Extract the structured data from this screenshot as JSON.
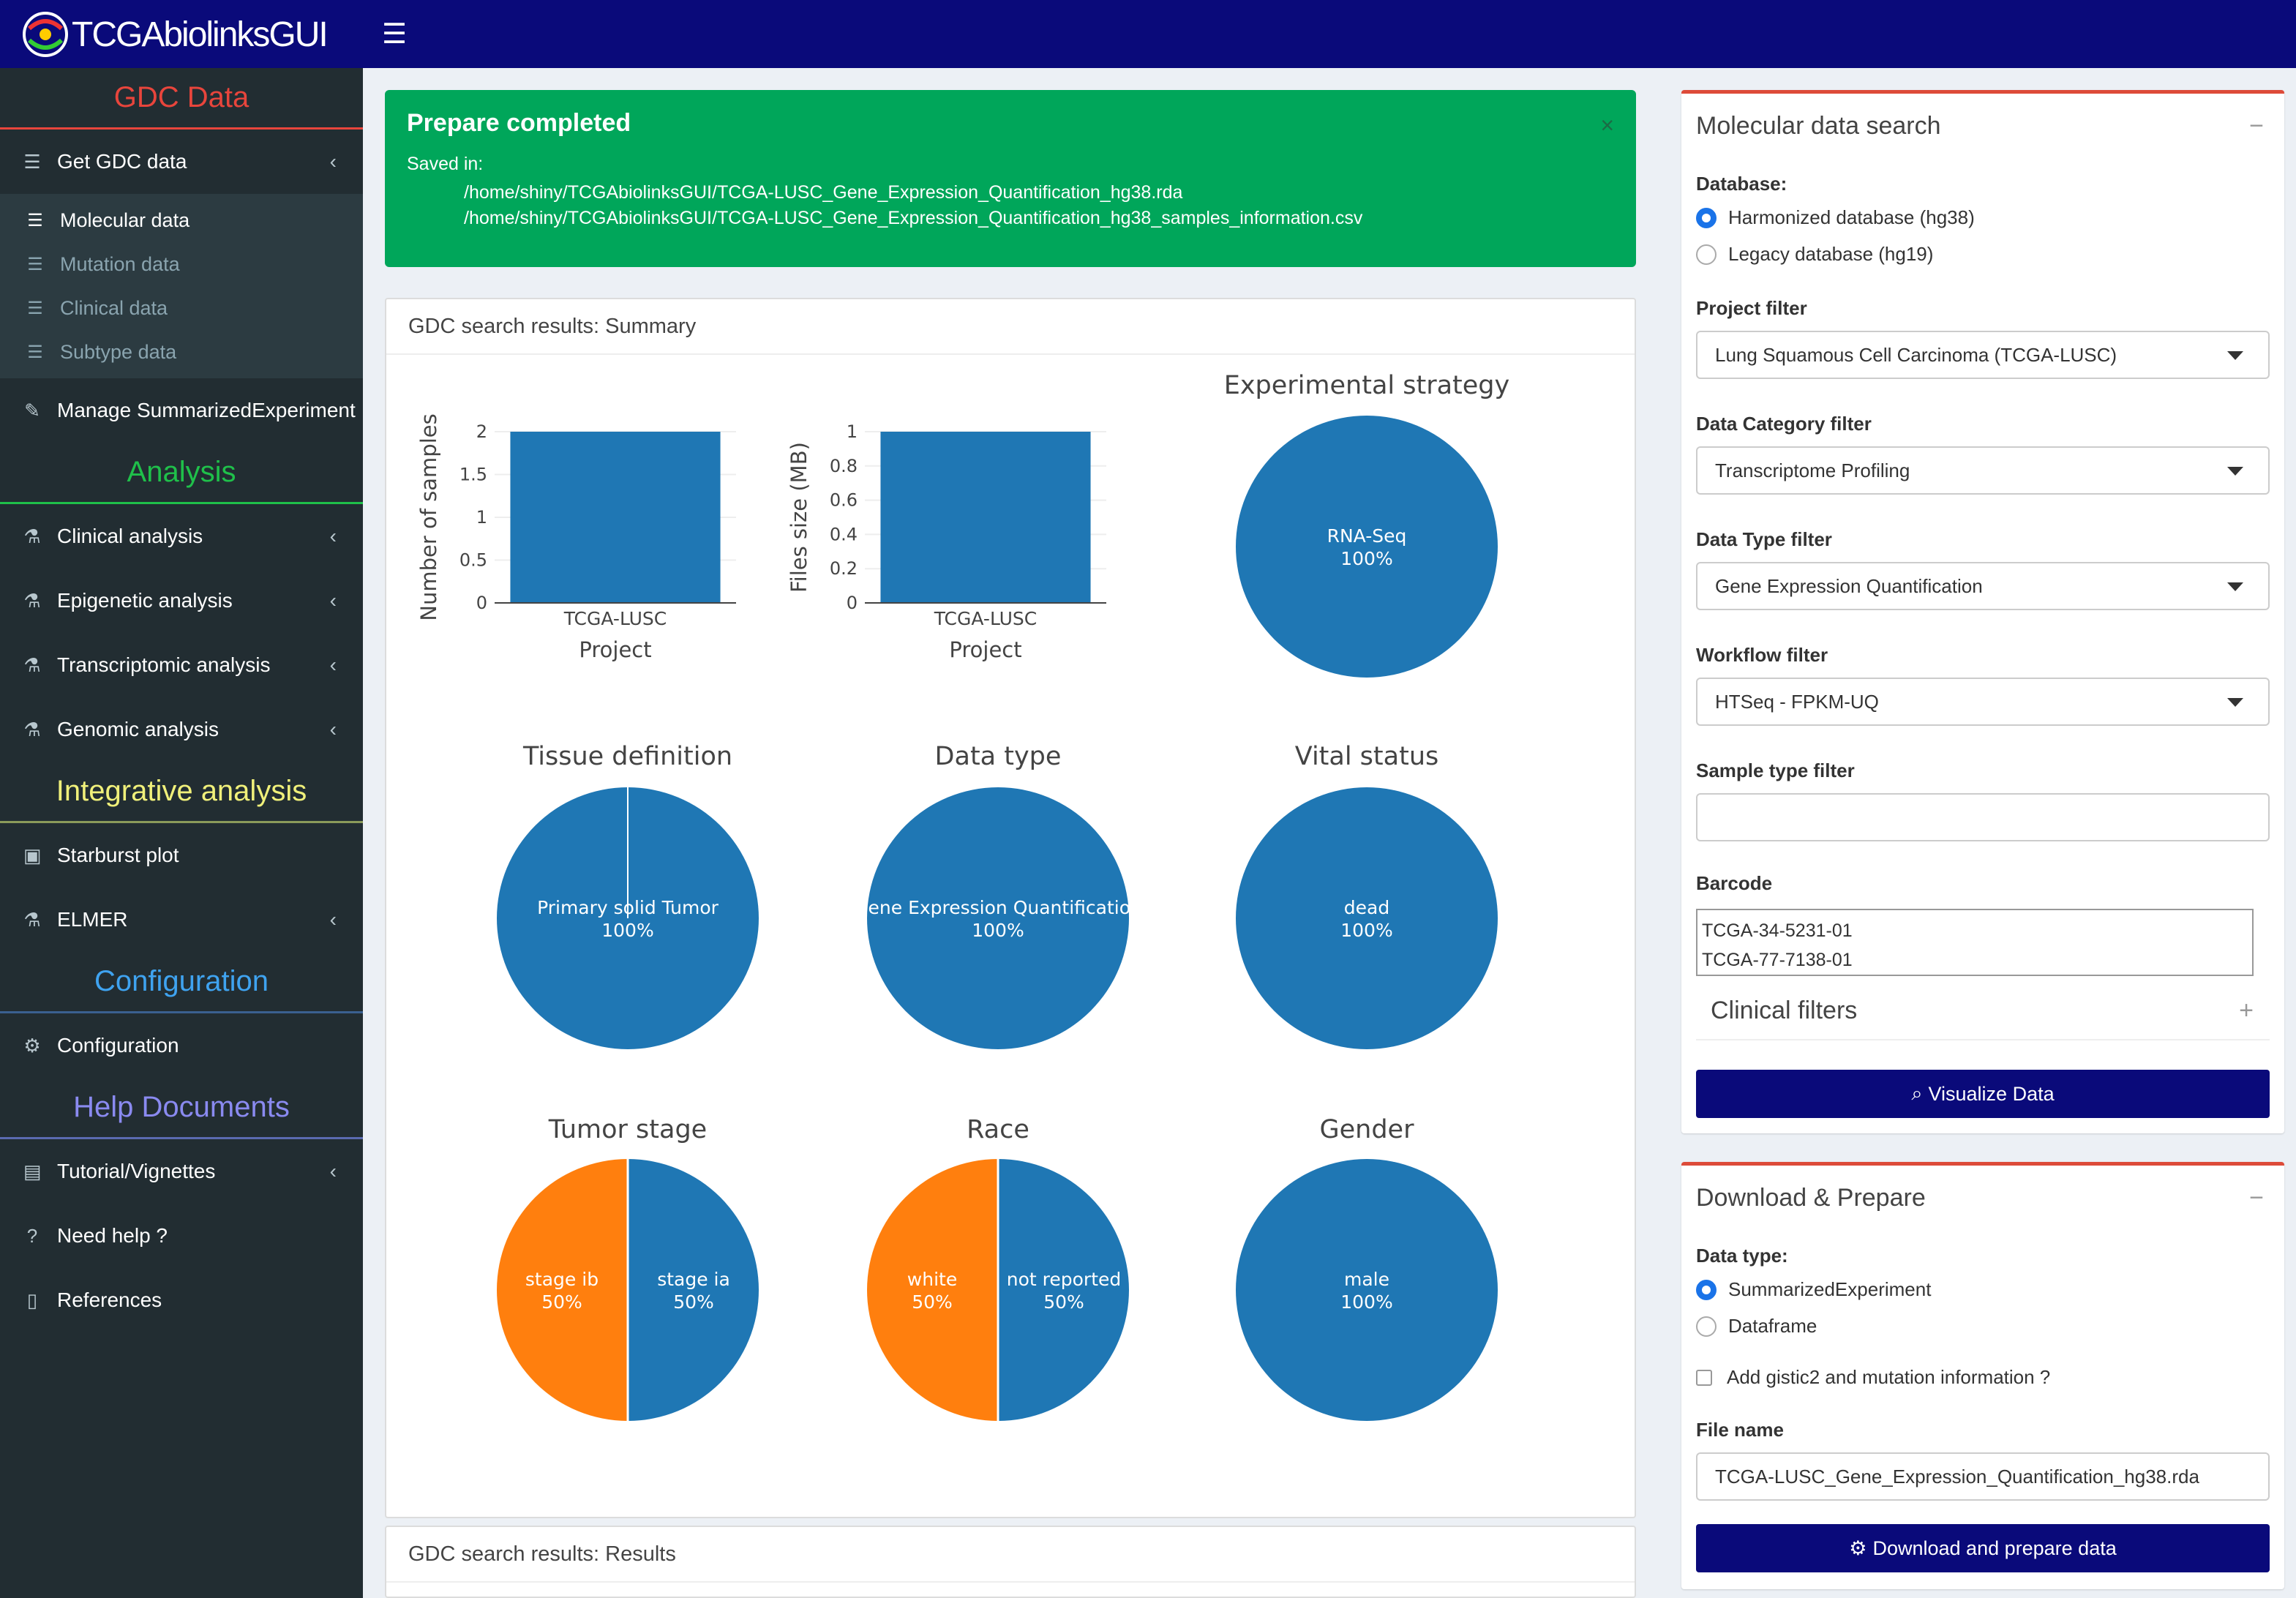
{
  "app": {
    "title": "TCGAbiolinksGUI"
  },
  "sidebar": {
    "sections": {
      "gdc": "GDC Data",
      "analysis": "Analysis",
      "integrative": "Integrative analysis",
      "config": "Configuration",
      "help": "Help Documents"
    },
    "section_colors": {
      "gdc": "#e8453c",
      "analysis": "#1fc04a",
      "integrative": "#f0f07a",
      "config": "#3fa3f0",
      "help": "#8a8af0"
    },
    "get_gdc": "Get GDC data",
    "sub": [
      "Molecular data",
      "Mutation data",
      "Clinical data",
      "Subtype data"
    ],
    "manage": "Manage SummarizedExperiment",
    "analysis_items": [
      "Clinical analysis",
      "Epigenetic analysis",
      "Transcriptomic analysis",
      "Genomic analysis"
    ],
    "integrative_items": [
      "Starburst plot",
      "ELMER"
    ],
    "configuration": "Configuration",
    "help_items": [
      "Tutorial/Vignettes",
      "Need help ?",
      "References"
    ]
  },
  "alert": {
    "title": "Prepare completed",
    "saved": "Saved in:",
    "paths": [
      "/home/shiny/TCGAbiolinksGUI/TCGA-LUSC_Gene_Expression_Quantification_hg38.rda",
      "/home/shiny/TCGAbiolinksGUI/TCGA-LUSC_Gene_Expression_Quantification_hg38_samples_information.csv"
    ],
    "close": "×"
  },
  "summary_title": "GDC search results: Summary",
  "results_title": "GDC search results: Results",
  "chart_data": [
    {
      "type": "bar",
      "categories": [
        "TCGA-LUSC"
      ],
      "values": [
        2
      ],
      "xlabel": "Project",
      "ylabel": "Number of samples",
      "ylim": [
        0,
        2
      ],
      "ticks": [
        "0",
        "0.5",
        "1",
        "1.5",
        "2"
      ],
      "color": "#1f77b4"
    },
    {
      "type": "bar",
      "categories": [
        "TCGA-LUSC"
      ],
      "values": [
        1
      ],
      "xlabel": "Project",
      "ylabel": "Files size (MB)",
      "ylim": [
        0,
        1
      ],
      "ticks": [
        "0",
        "0.2",
        "0.4",
        "0.6",
        "0.8",
        "1"
      ],
      "color": "#1f77b4"
    },
    {
      "type": "pie",
      "title": "Experimental strategy",
      "slices": [
        {
          "label": "RNA-Seq",
          "pct": "100%",
          "value": 100
        }
      ]
    },
    {
      "type": "pie",
      "title": "Tissue definition",
      "slices": [
        {
          "label": "Primary solid Tumor",
          "pct": "100%",
          "value": 100
        }
      ]
    },
    {
      "type": "pie",
      "title": "Data type",
      "slices": [
        {
          "label": "Gene Expression Quantification",
          "pct": "100%",
          "value": 100
        }
      ]
    },
    {
      "type": "pie",
      "title": "Vital status",
      "slices": [
        {
          "label": "dead",
          "pct": "100%",
          "value": 100
        }
      ]
    },
    {
      "type": "pie",
      "title": "Tumor stage",
      "slices": [
        {
          "label": "stage ia",
          "pct": "50%",
          "value": 50
        },
        {
          "label": "stage ib",
          "pct": "50%",
          "value": 50
        }
      ]
    },
    {
      "type": "pie",
      "title": "Race",
      "slices": [
        {
          "label": "not reported",
          "pct": "50%",
          "value": 50
        },
        {
          "label": "white",
          "pct": "50%",
          "value": 50
        }
      ]
    },
    {
      "type": "pie",
      "title": "Gender",
      "slices": [
        {
          "label": "male",
          "pct": "100%",
          "value": 100
        }
      ]
    }
  ],
  "colors": {
    "blue": "#1f77b4",
    "orange": "#ff7f0e"
  },
  "search": {
    "title": "Molecular data search",
    "collapse": "−",
    "database_label": "Database:",
    "db_options": [
      "Harmonized database (hg38)",
      "Legacy database (hg19)"
    ],
    "project_label": "Project filter",
    "project_value": "Lung Squamous Cell Carcinoma (TCGA-LUSC)",
    "category_label": "Data Category filter",
    "category_value": "Transcriptome Profiling",
    "type_label": "Data Type filter",
    "type_value": "Gene Expression Quantification",
    "workflow_label": "Workflow filter",
    "workflow_value": "HTSeq - FPKM-UQ",
    "sample_label": "Sample type filter",
    "barcode_label": "Barcode",
    "barcodes": [
      "TCGA-34-5231-01",
      "TCGA-77-7138-01"
    ],
    "clinical_filters": "Clinical filters",
    "expand": "+",
    "visualize": "Visualize Data"
  },
  "download": {
    "title": "Download & Prepare",
    "collapse": "−",
    "dtype_label": "Data type:",
    "dtype_options": [
      "SummarizedExperiment",
      "Dataframe"
    ],
    "gistic": "Add gistic2 and mutation information ?",
    "file_label": "File name",
    "file_value": "TCGA-LUSC_Gene_Expression_Quantification_hg38.rda",
    "button": "Download and prepare data"
  }
}
